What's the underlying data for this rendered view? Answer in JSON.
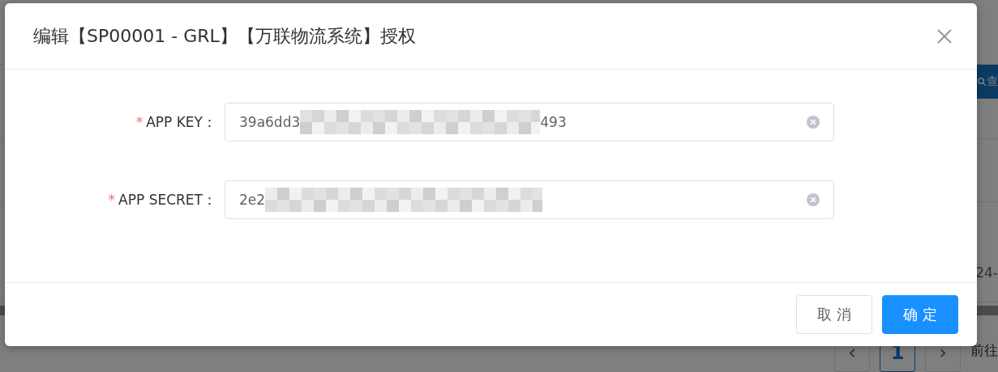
{
  "background": {
    "search_button": {
      "label": "查"
    },
    "cell_text": "24-",
    "pagination": {
      "prev": "‹",
      "pages": [
        {
          "label": "1",
          "selected": true
        }
      ],
      "next": "›",
      "goto_label": "前往"
    }
  },
  "dialog": {
    "title": "编辑【SP00001 - GRL】【万联物流系统】授权",
    "fields": [
      {
        "required_mark": "*",
        "label": "APP KEY：",
        "value": "39a6dd3",
        "redacted": true,
        "value_tail": "493",
        "clearable": true
      },
      {
        "required_mark": "*",
        "label": "APP SECRET：",
        "value": "2e2",
        "redacted": true,
        "clearable": true
      }
    ],
    "buttons": [
      {
        "label": "取 消",
        "kind": "default"
      },
      {
        "label": "确 定",
        "kind": "primary"
      }
    ]
  }
}
